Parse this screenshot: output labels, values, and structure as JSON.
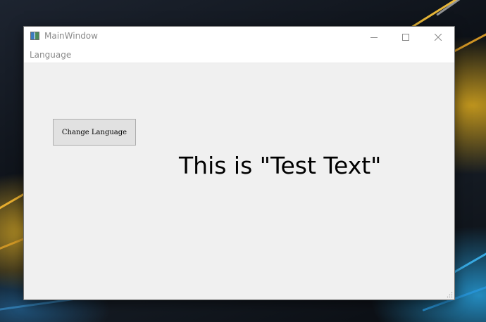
{
  "window": {
    "title": "MainWindow"
  },
  "menubar": {
    "items": [
      {
        "label": "Language"
      }
    ]
  },
  "content": {
    "button_label": "Change Language",
    "label_text": "This is \"Test Text\""
  },
  "icons": {
    "app": "app-icon",
    "minimize": "minimize-icon",
    "maximize": "maximize-icon",
    "close": "close-icon",
    "resize": "size-grip-icon"
  }
}
